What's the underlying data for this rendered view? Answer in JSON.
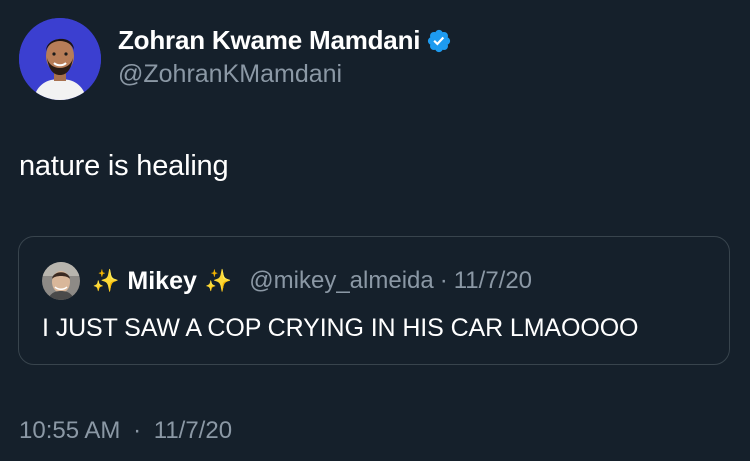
{
  "author": {
    "display_name": "Zohran Kwame Mamdani",
    "handle": "@ZohranKMamdani",
    "verified_icon": "verified-badge-icon"
  },
  "tweet": {
    "text": "nature is healing"
  },
  "quote": {
    "sparkle_left": "✨",
    "name": "Mikey",
    "sparkle_right": "✨",
    "handle": "@mikey_almeida",
    "separator": "·",
    "date": "11/7/20",
    "text": "I JUST SAW A COP CRYING IN HIS CAR LMAOOOO"
  },
  "timestamp": {
    "time": "10:55 AM",
    "separator": "·",
    "date": "11/7/20"
  },
  "colors": {
    "background": "#15202b",
    "primary_text": "#ffffff",
    "secondary_text": "#8b98a5",
    "verified_blue": "#1d9bf0",
    "border": "#38444d",
    "avatar_bg": "#3b3fd0"
  }
}
